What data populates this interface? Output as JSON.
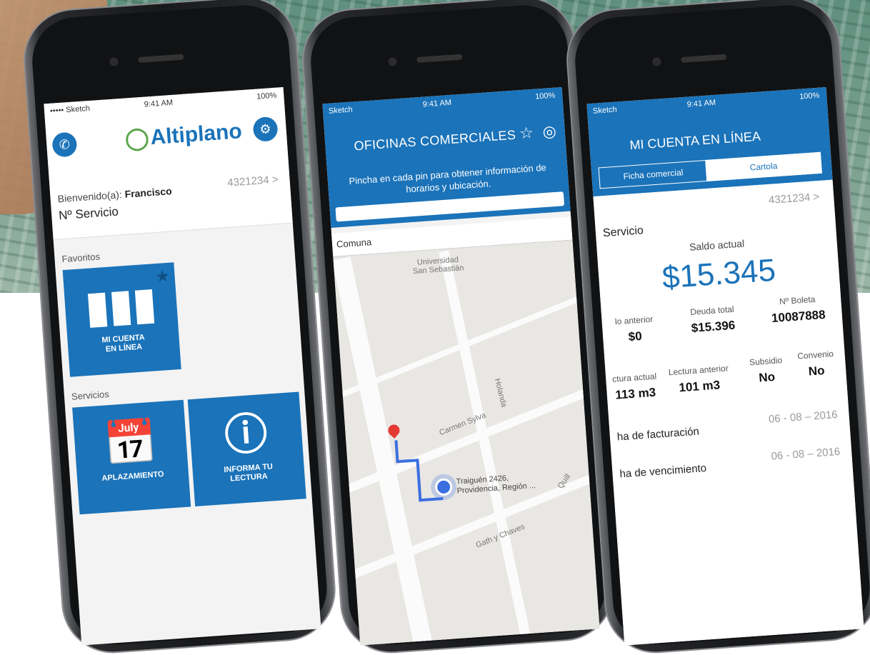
{
  "colors": {
    "brand_blue": "#1b73b9",
    "brand_green": "#5aa64b"
  },
  "phone1": {
    "status": {
      "carrier": "••••• Sketch",
      "time": "9:41 AM",
      "battery": "100%"
    },
    "header": {
      "logo_text": "Altiplano",
      "phone_icon": "phone-icon",
      "gear_icon": "gear-icon"
    },
    "welcome": {
      "greeting_prefix": "Bienvenido(a): ",
      "name": "Francisco",
      "service_label": "Nº Servicio",
      "service_number": "4321234 >"
    },
    "favorites_label": "Favoritos",
    "favorite_tile": {
      "label_line1": "MI CUENTA",
      "label_line2": "EN LÍNEA"
    },
    "services_label": "Servicios",
    "service_tiles": [
      {
        "icon": "calendar-icon",
        "label_line1": "APLAZAMIENTO"
      },
      {
        "icon": "info-icon",
        "label_line1": "INFORMA TU",
        "label_line2": "LECTURA"
      }
    ]
  },
  "phone2": {
    "status": {
      "carrier": "Sketch",
      "time": "9:41 AM",
      "battery": "100%"
    },
    "title": "OFICINAS COMERCIALES",
    "subtitle": "Pincha en cada pin para obtener información de horarios y ubicación.",
    "comuna_label": "Comuna",
    "map": {
      "labels": [
        "Universidad",
        "San Sebastián",
        "Carmen Sylva",
        "Holanda",
        "Traiguén 2426,",
        "Providencia, Región ...",
        "Gath y Chaves",
        "Quill"
      ]
    }
  },
  "phone3": {
    "status": {
      "carrier": "Sketch",
      "time": "9:41 AM",
      "battery": "100%"
    },
    "title": "MI CUENTA EN LÍNEA",
    "tabs": [
      "Ficha comercial",
      "Cartola"
    ],
    "account_number": "4321234 >",
    "service_label": "Servicio",
    "saldo_label": "Saldo actual",
    "saldo_value": "$15.345",
    "summary": [
      {
        "label": "lo anterior",
        "value": "$0"
      },
      {
        "label": "Deuda total",
        "value": "$15.396"
      },
      {
        "label": "Nº Boleta",
        "value": "10087888"
      }
    ],
    "readings": [
      {
        "label": "ctura actual",
        "value": "113 m3"
      },
      {
        "label": "Lectura anterior",
        "value": "101 m3"
      },
      {
        "label": "Subsidio",
        "value": "No"
      },
      {
        "label": "Convenio",
        "value": "No"
      }
    ],
    "dates": [
      {
        "label": "ha de facturación",
        "value": "06 - 08 – 2016"
      },
      {
        "label": "ha de vencimiento",
        "value": "06 - 08 – 2016"
      }
    ]
  }
}
